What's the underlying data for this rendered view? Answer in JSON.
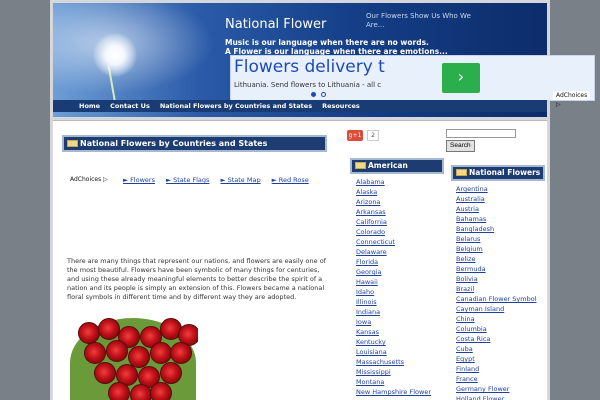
{
  "header": {
    "site_title": "National Flower",
    "slogan": "Our Flowers Show Us Who We Are...",
    "tagline_1": "Music is our language when there are no words.",
    "tagline_2": "A Flower is our language when there are emotions..."
  },
  "ad_banner": {
    "headline": "Flowers delivery t",
    "subtext": "Lithuania. Send flowers to Lithuania - all c",
    "arrow": "›",
    "adchoices": "AdChoices ▷"
  },
  "nav": [
    "Home",
    "Contact Us",
    "National Flowers by Countries and States",
    "Resources"
  ],
  "main": {
    "section_title": "National Flowers by Countries and States",
    "adchoices": "AdChoices ▷",
    "ad_links": [
      "► Flowers",
      "► State Flags",
      "► State Map",
      "► Red Rose"
    ],
    "intro": "There are many things that represent our nations, and flowers are easily one of the most beautiful. Flowers have been symbolic of many things for centuries, and using these already meaningful elements to better describe the spirit of a nation and its people is simply an extension of this. Flowers became a national floral symbols in different time and by different way they are adopted."
  },
  "social": {
    "gplus_label": "g+1",
    "gplus_count": "2"
  },
  "search": {
    "button": "Search",
    "placeholder": ""
  },
  "american_flowers": {
    "title": "American Flowers",
    "items": [
      "Alabama",
      "Alaska",
      "Arizona",
      "Arkansas",
      "California",
      "Colorado",
      "Connecticut",
      "Delaware",
      "Florida",
      "Georgia",
      "Hawaii",
      "Idaho",
      "Illinois",
      "Indiana",
      "Iowa",
      "Kansas",
      "Kentucky",
      "Louisiana",
      "Massachusetts",
      "Mississippi",
      "Montana",
      "New Hampshire Flower"
    ]
  },
  "national_flowers": {
    "title": "National Flowers",
    "items": [
      "Argentina",
      "Australia",
      "Austria",
      "Bahamas",
      "Bangladesh",
      "Belarus",
      "Belgium",
      "Belize",
      "Bermuda",
      "Bolivia",
      "Brazil",
      "Canadian Flower Symbol",
      "Cayman Island",
      "China",
      "Columbia",
      "Costa Rica",
      "Cuba",
      "Egypt",
      "Finland",
      "France",
      "Germany Flower",
      "Holland Flower"
    ]
  },
  "colors": {
    "nav_bg": "#1a3c74",
    "link": "#1f3f9f",
    "ad_headline": "#1c4ab8",
    "ad_button": "#2bae4c"
  }
}
